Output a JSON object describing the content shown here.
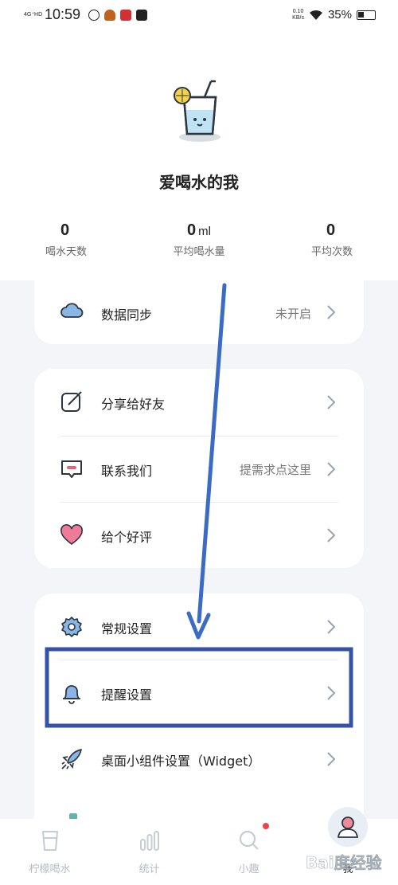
{
  "status_bar": {
    "network": "4G⁺HD",
    "time": "10:59",
    "speed": "0.10",
    "speed_unit": "KB/s",
    "battery": "35%"
  },
  "profile": {
    "username": "爱喝水的我",
    "stats": [
      {
        "value": "0",
        "unit": "",
        "label": "喝水天数"
      },
      {
        "value": "0",
        "unit": "ml",
        "label": "平均喝水量"
      },
      {
        "value": "0",
        "unit": "",
        "label": "平均次数"
      }
    ]
  },
  "menu": {
    "sync": {
      "label": "数据同步",
      "value": "未开启",
      "icon": "cloud-icon"
    },
    "share": {
      "label": "分享给好友",
      "icon": "share-icon"
    },
    "contact": {
      "label": "联系我们",
      "value": "提需求点这里",
      "icon": "message-icon"
    },
    "rate": {
      "label": "给个好评",
      "icon": "heart-icon"
    },
    "general": {
      "label": "常规设置",
      "icon": "gear-icon"
    },
    "reminder": {
      "label": "提醒设置",
      "icon": "bell-icon"
    },
    "widget": {
      "label": "桌面小组件设置（Widget）",
      "icon": "rocket-icon"
    }
  },
  "tabs": [
    {
      "label": "柠檬喝水",
      "icon": "cup-icon"
    },
    {
      "label": "统计",
      "icon": "bar-chart-icon"
    },
    {
      "label": "小趣",
      "icon": "search-icon"
    },
    {
      "label": "我",
      "icon": "user-icon",
      "active": true
    }
  ],
  "colors": {
    "accent_blue": "#3b6bc4",
    "highlight_box": "#3552a6",
    "heart": "#f07a9a",
    "cloud": "#8ab6e6",
    "background": "#f3f5f8"
  },
  "watermark": "Bai度经验"
}
